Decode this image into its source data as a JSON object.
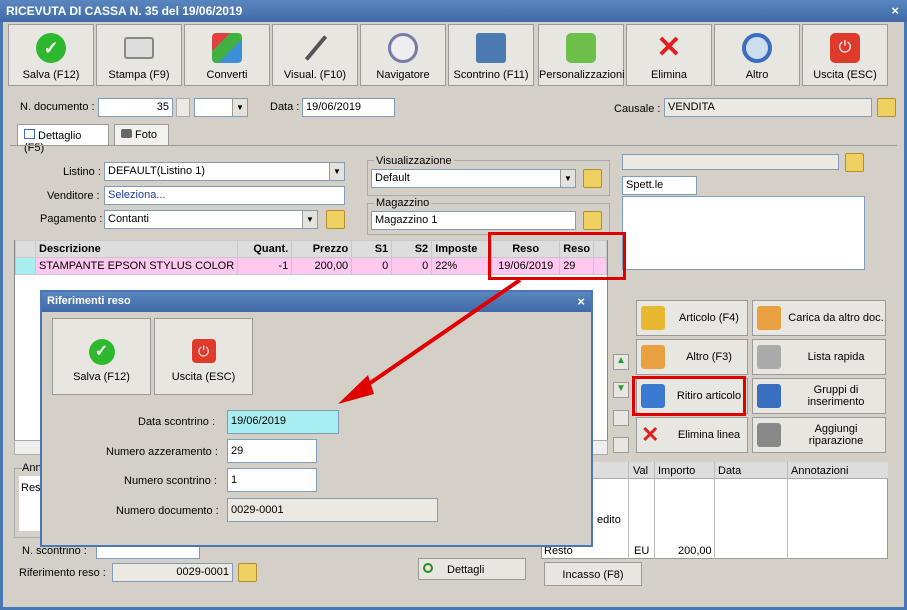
{
  "window": {
    "title": "RICEVUTA DI CASSA N. 35 del 19/06/2019",
    "close": "×"
  },
  "toolbar": [
    {
      "label": "Salva (F12)",
      "icon": "check-icon",
      "color": "#2eb82e"
    },
    {
      "label": "Stampa (F9)",
      "icon": "printer-icon",
      "color": "#888888"
    },
    {
      "label": "Converti",
      "icon": "convert-icon",
      "color": "#3c8fd9"
    },
    {
      "label": "Visual. (F10)",
      "icon": "magic-wand-icon",
      "color": "#555555"
    },
    {
      "label": "Navigatore",
      "icon": "compass-icon",
      "color": "#7a7aa8"
    },
    {
      "label": "Scontrino (F11)",
      "icon": "cash-register-icon",
      "color": "#4a7ab0"
    },
    {
      "label": "Personalizzazioni",
      "icon": "puzzle-icon",
      "color": "#6cc04a"
    },
    {
      "label": "Elimina",
      "icon": "x-icon",
      "color": "#e02020"
    },
    {
      "label": "Altro",
      "icon": "magnifier-icon",
      "color": "#3a6fc0"
    },
    {
      "label": "Uscita (ESC)",
      "icon": "power-icon",
      "color": "#e03a2a"
    }
  ],
  "header": {
    "ndoc_label": "N. documento :",
    "ndoc_value": "35",
    "data_label": "Data :",
    "data_value": "19/06/2019",
    "causale_label": "Causale :",
    "causale_value": "VENDITA"
  },
  "tabs": [
    {
      "label": "Dettaglio (F5)"
    },
    {
      "label": "Foto"
    }
  ],
  "form": {
    "listino_label": "Listino :",
    "listino_value": "DEFAULT(Listino 1)",
    "venditore_label": "Venditore :",
    "venditore_value": "Seleziona...",
    "pagamento_label": "Pagamento :",
    "pagamento_value": "Contanti",
    "visualizzazione_label": "Visualizzazione",
    "visualizzazione_value": "Default",
    "magazzino_label": "Magazzino",
    "magazzino_value": "Magazzino 1",
    "spett": "Spett.le"
  },
  "grid": {
    "headers": [
      "Descrizione",
      "Quant.",
      "Prezzo",
      "S1",
      "S2",
      "Imposte",
      "Reso",
      "Reso"
    ],
    "row": [
      "STAMPANTE EPSON STYLUS COLOR",
      "-1",
      "200,00",
      "0",
      "0",
      "22%",
      "19/06/2019",
      "29"
    ]
  },
  "actions": [
    {
      "label": "Articolo (F4)",
      "icon": "box-add-icon"
    },
    {
      "label": "Carica da altro doc.",
      "icon": "grid-check-icon"
    },
    {
      "label": "Altro (F3)",
      "icon": "grid-add-icon"
    },
    {
      "label": "Lista rapida",
      "icon": "scanner-icon"
    },
    {
      "label": "Ritiro articolo",
      "icon": "undo-icon"
    },
    {
      "label": "Gruppi di inserimento",
      "icon": "group-add-icon"
    },
    {
      "label": "Elimina linea",
      "icon": "x-icon"
    },
    {
      "label": "Aggiungi riparazione",
      "icon": "wrench-icon"
    }
  ],
  "payments": {
    "headers": [
      "Val",
      "Importo",
      "Data",
      "Annotazioni"
    ],
    "credito": "edito",
    "resto_label": "Resto",
    "resto_val": "EU",
    "resto_importo": "200,00"
  },
  "bottom": {
    "ann_label": "Ann",
    "res_text": "Res",
    "nscontrino_label": "N. scontrino :",
    "rifreso_label": "Riferimento reso :",
    "rifreso_value": "0029-0001",
    "dettagli": "Dettagli",
    "incasso": "Incasso (F8)"
  },
  "dialog": {
    "title": "Riferimenti reso",
    "close": "×",
    "save": "Salva (F12)",
    "exit": "Uscita (ESC)",
    "data_label": "Data scontrino :",
    "data_value": "19/06/2019",
    "azz_label": "Numero azzeramento :",
    "azz_value": "29",
    "nsc_label": "Numero scontrino :",
    "nsc_value": "1",
    "ndoc_label": "Numero documento :",
    "ndoc_value": "0029-0001"
  },
  "colors": {
    "title": "#4a78b5",
    "highlight_row": "#ffc8f0",
    "annotation": "#e00000",
    "date_field": "#a8eef0"
  }
}
